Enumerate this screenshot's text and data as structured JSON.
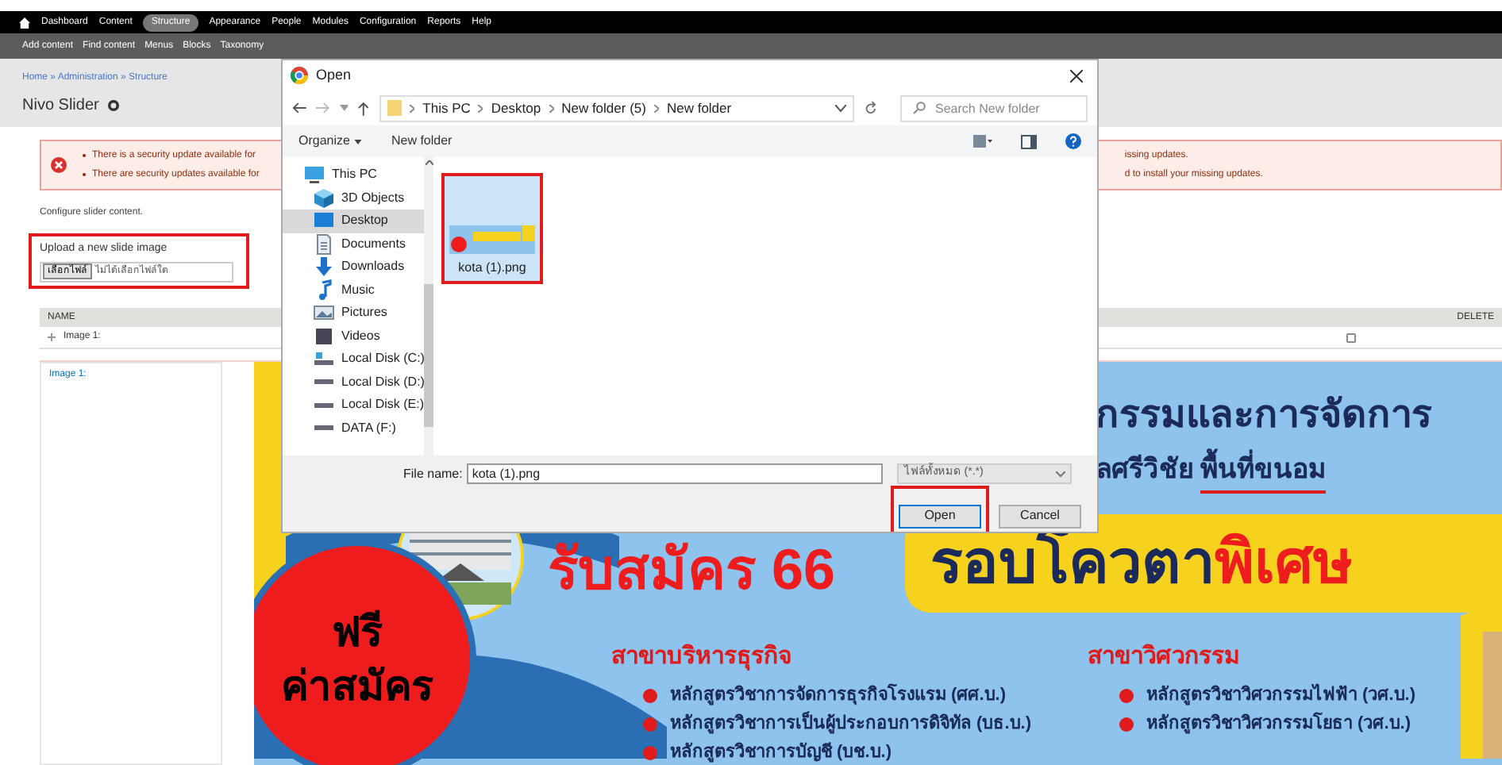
{
  "toolbar": {
    "menu": [
      {
        "label": "Dashboard",
        "selected": false
      },
      {
        "label": "Content",
        "selected": false
      },
      {
        "label": "Structure",
        "selected": true
      },
      {
        "label": "Appearance",
        "selected": false
      },
      {
        "label": "People",
        "selected": false
      },
      {
        "label": "Modules",
        "selected": false
      },
      {
        "label": "Configuration",
        "selected": false
      },
      {
        "label": "Reports",
        "selected": false
      },
      {
        "label": "Help",
        "selected": false
      }
    ],
    "shortcuts": [
      "Add content",
      "Find content",
      "Menus",
      "Blocks",
      "Taxonomy"
    ]
  },
  "header": {
    "breadcrumb": "Home » Administration » Structure",
    "title": "Nivo Slider"
  },
  "messages": [
    {
      "left": "There is a security update available for",
      "right": "issing updates."
    },
    {
      "left": "There are security updates available for",
      "right": "d to install your missing updates."
    }
  ],
  "intro": "Configure slider content.",
  "upload": {
    "label": "Upload a new slide image",
    "button": "เลือกไฟล์",
    "status": "ไม่ได้เลือกไฟล์ใด"
  },
  "table": {
    "columns": [
      "NAME",
      "DELETE"
    ],
    "rows": [
      {
        "name": "Image 1:",
        "delete": false
      }
    ]
  },
  "slide_editor": {
    "label": "Image 1:",
    "banner": {
      "heading": "กรรมและการจัดการ",
      "subtitle": "ลศรีวิชัย",
      "subtitle_highlight": "พื้นที่ขนอม",
      "headline": "รับสมัคร 66",
      "quota": "รอบโควตา",
      "quota_highlight": "พิเศษ",
      "badge": [
        "ฟรี",
        "ค่าสมัคร"
      ],
      "programs": [
        {
          "title": "สาขาบริหารธุรกิจ",
          "items": [
            "หลักสูตรวิชาการจัดการธุรกิจโรงแรม (ศศ.บ.)",
            "หลักสูตรวิชาการเป็นผู้ประกอบการดิจิทัล (บธ.บ.)",
            "หลักสูตรวิชาการบัญชี (บช.บ.)"
          ]
        },
        {
          "title": "สาขาวิศวกรรม",
          "items": [
            "หลักสูตรวิชาวิศวกรรมไฟฟ้า (วศ.บ.)",
            "หลักสูตรวิชาวิศวกรรมโยธา (วศ.บ.)"
          ]
        }
      ]
    }
  },
  "dialog": {
    "title": "Open",
    "path": [
      "This PC",
      "Desktop",
      "New folder (5)",
      "New folder"
    ],
    "search_placeholder": "Search New folder",
    "actions": [
      "Organize",
      "New folder"
    ],
    "nav": [
      {
        "label": "This PC",
        "kind": "pc",
        "selected": false
      },
      {
        "label": "3D Objects",
        "kind": "objects",
        "selected": false
      },
      {
        "label": "Desktop",
        "kind": "desktop",
        "selected": true
      },
      {
        "label": "Documents",
        "kind": "documents",
        "selected": false
      },
      {
        "label": "Downloads",
        "kind": "downloads",
        "selected": false
      },
      {
        "label": "Music",
        "kind": "music",
        "selected": false
      },
      {
        "label": "Pictures",
        "kind": "pictures",
        "selected": false
      },
      {
        "label": "Videos",
        "kind": "videos",
        "selected": false
      },
      {
        "label": "Local Disk (C:)",
        "kind": "system-drive",
        "selected": false
      },
      {
        "label": "Local Disk (D:)",
        "kind": "drive",
        "selected": false
      },
      {
        "label": "Local Disk (E:)",
        "kind": "drive",
        "selected": false
      },
      {
        "label": "DATA (F:)",
        "kind": "drive",
        "selected": false
      }
    ],
    "files": [
      {
        "name": "kota (1).png",
        "selected": true
      }
    ],
    "file_name_label": "File name:",
    "file_name": "kota (1).png",
    "file_type": "ไฟล์ทั้งหมด (*.*)",
    "buttons": [
      "Open",
      "Cancel"
    ]
  }
}
